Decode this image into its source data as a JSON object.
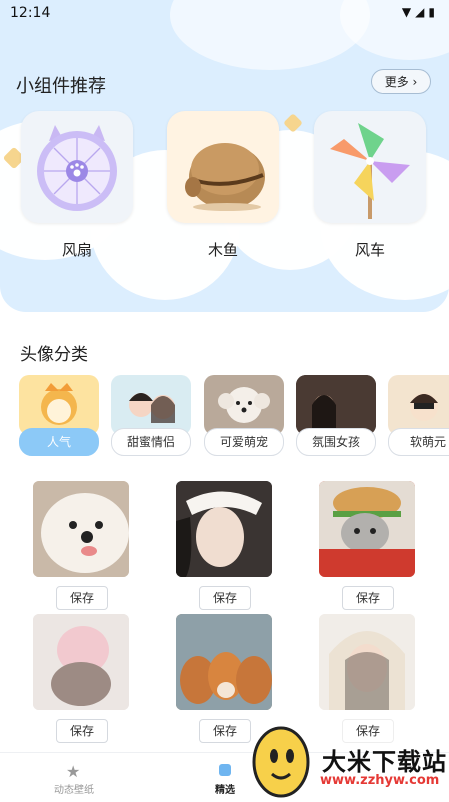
{
  "status_bar": {
    "time": "12:14"
  },
  "widgets": {
    "title": "小组件推荐",
    "more_label": "更多 ›",
    "items": [
      {
        "label": "风扇",
        "icon": "fan-icon"
      },
      {
        "label": "木鱼",
        "icon": "wooden-fish-icon"
      },
      {
        "label": "风车",
        "icon": "pinwheel-icon"
      }
    ]
  },
  "avatars": {
    "title": "头像分类",
    "categories": [
      {
        "label": "人气",
        "active": true
      },
      {
        "label": "甜蜜情侣",
        "active": false
      },
      {
        "label": "可爱萌宠",
        "active": false
      },
      {
        "label": "氛围女孩",
        "active": false
      },
      {
        "label": "软萌元",
        "active": false
      }
    ]
  },
  "photos": {
    "save_label": "保存"
  },
  "bottom_nav": {
    "items": [
      {
        "label": "动态壁纸",
        "icon": "star-icon",
        "active": false
      },
      {
        "label": "精选",
        "icon": "hexagon-icon",
        "active": true
      }
    ]
  },
  "watermark": {
    "text": "大米下载站",
    "url": "www.zzhyw.com"
  },
  "colors": {
    "accent": "#8cc9f7",
    "sky": "#dceefe",
    "watermark_url": "#e53935"
  }
}
